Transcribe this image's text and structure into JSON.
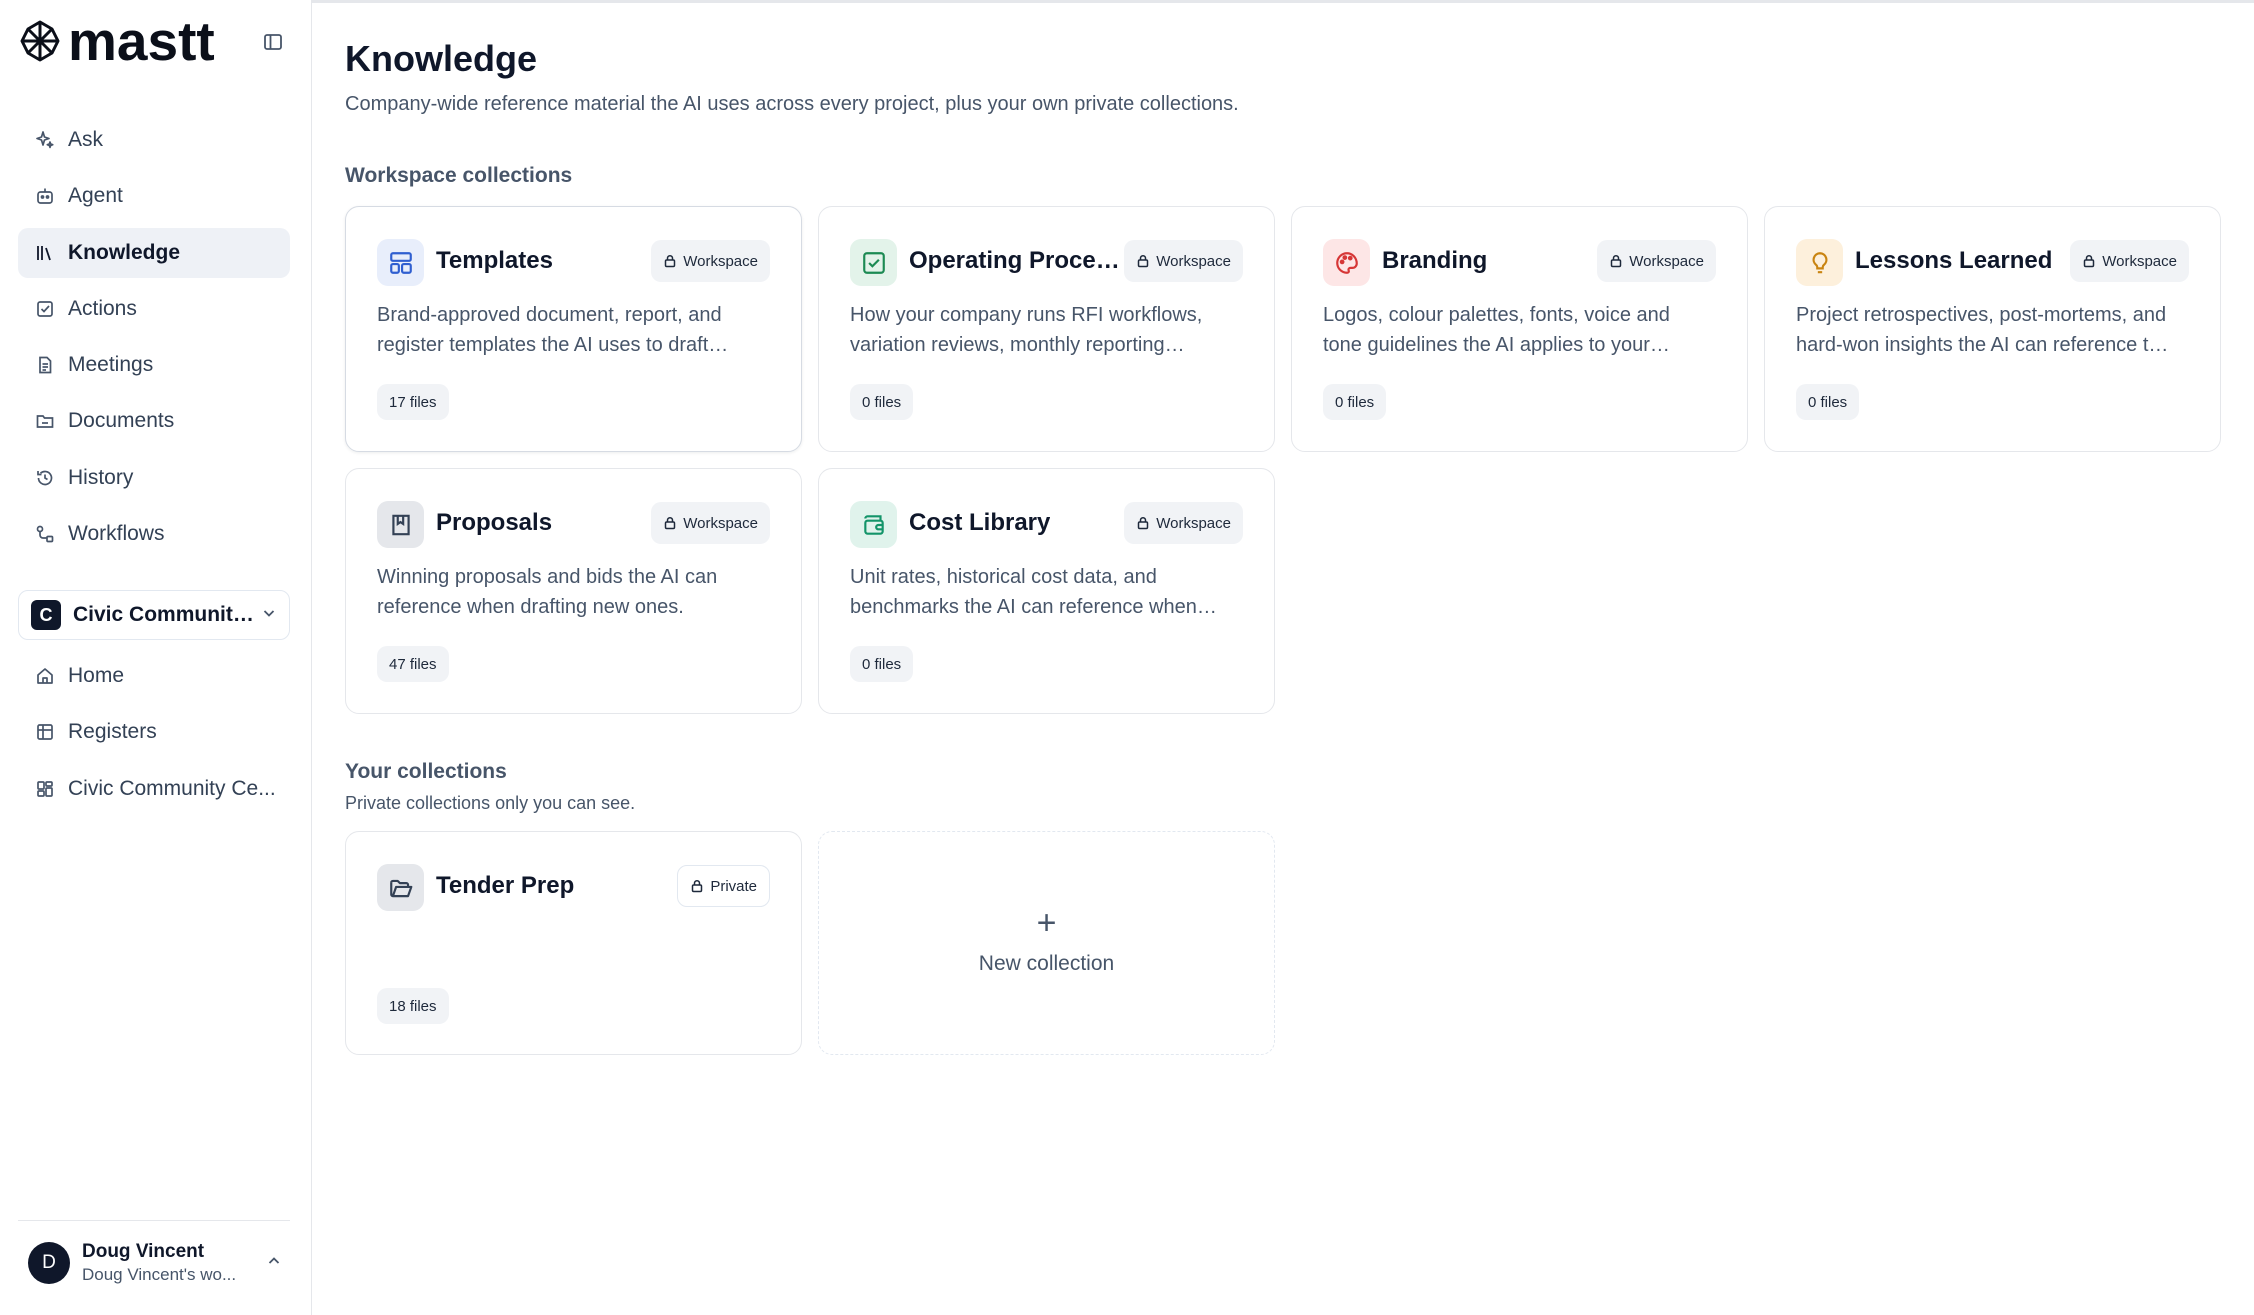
{
  "app": {
    "brand": "mastt"
  },
  "sidebar": {
    "nav": [
      {
        "label": "Ask",
        "icon": "sparkles-icon"
      },
      {
        "label": "Agent",
        "icon": "bot-icon"
      },
      {
        "label": "Knowledge",
        "icon": "library-icon",
        "active": true
      },
      {
        "label": "Actions",
        "icon": "check-square-icon"
      },
      {
        "label": "Meetings",
        "icon": "document-icon"
      },
      {
        "label": "Documents",
        "icon": "folder-icon"
      },
      {
        "label": "History",
        "icon": "history-icon"
      },
      {
        "label": "Workflows",
        "icon": "workflow-icon"
      }
    ],
    "project": {
      "initial": "C",
      "name": "Civic Community…"
    },
    "project_nav": [
      {
        "label": "Home",
        "icon": "home-icon"
      },
      {
        "label": "Registers",
        "icon": "table-icon"
      },
      {
        "label": "Civic Community Ce...",
        "icon": "dashboard-icon"
      }
    ],
    "user": {
      "initial": "D",
      "name": "Doug Vincent",
      "workspace": "Doug Vincent's wo..."
    }
  },
  "page": {
    "title": "Knowledge",
    "subtitle": "Company-wide reference material the AI uses across every project, plus your own private collections."
  },
  "workspace_section": {
    "title": "Workspace collections",
    "cards": [
      {
        "title": "Templates",
        "badge": "Workspace",
        "desc1": "Brand-approved document, report, and",
        "desc2": "register templates the AI uses to draft…",
        "count": "17 files",
        "icon": "layout-template-icon"
      },
      {
        "title": "Operating Proced...",
        "badge": "Workspace",
        "desc1": "How your company runs RFI workflows,",
        "desc2": "variation reviews, monthly reporting…",
        "count": "0 files",
        "icon": "checklist-icon"
      },
      {
        "title": "Branding",
        "badge": "Workspace",
        "desc1": "Logos, colour palettes, fonts, voice and",
        "desc2": "tone guidelines the AI applies to your…",
        "count": "0 files",
        "icon": "palette-icon"
      },
      {
        "title": "Lessons Learned",
        "badge": "Workspace",
        "desc1": "Project retrospectives, post-mortems, and",
        "desc2": "hard-won insights the AI can reference t…",
        "count": "0 files",
        "icon": "lightbulb-icon"
      },
      {
        "title": "Proposals",
        "badge": "Workspace",
        "desc1": "Winning proposals and bids the AI can",
        "desc2": "reference when drafting new ones.",
        "count": "47 files",
        "icon": "book-icon"
      },
      {
        "title": "Cost Library",
        "badge": "Workspace",
        "desc1": "Unit rates, historical cost data, and",
        "desc2": "benchmarks the AI can reference when…",
        "count": "0 files",
        "icon": "wallet-icon"
      }
    ]
  },
  "your_section": {
    "title": "Your collections",
    "subtitle": "Private collections only you can see.",
    "cards": [
      {
        "title": "Tender Prep",
        "badge": "Private",
        "count": "18 files",
        "icon": "folder-open-icon"
      }
    ],
    "new_label": "New collection",
    "new_plus": "+"
  },
  "colors": {
    "templates_bg": "#e8eefb",
    "templates_fg": "#2f5fd0",
    "sop_bg": "#e3f3ea",
    "sop_fg": "#1c8a53",
    "branding_bg": "#fde6e6",
    "branding_fg": "#d63636",
    "lessons_bg": "#fdf0dc",
    "lessons_fg": "#c98411",
    "proposals_bg": "#e5e7eb",
    "proposals_fg": "#334155",
    "cost_bg": "#e0f3ec",
    "cost_fg": "#139469",
    "private_bg": "#e5e7eb",
    "private_fg": "#334155"
  }
}
